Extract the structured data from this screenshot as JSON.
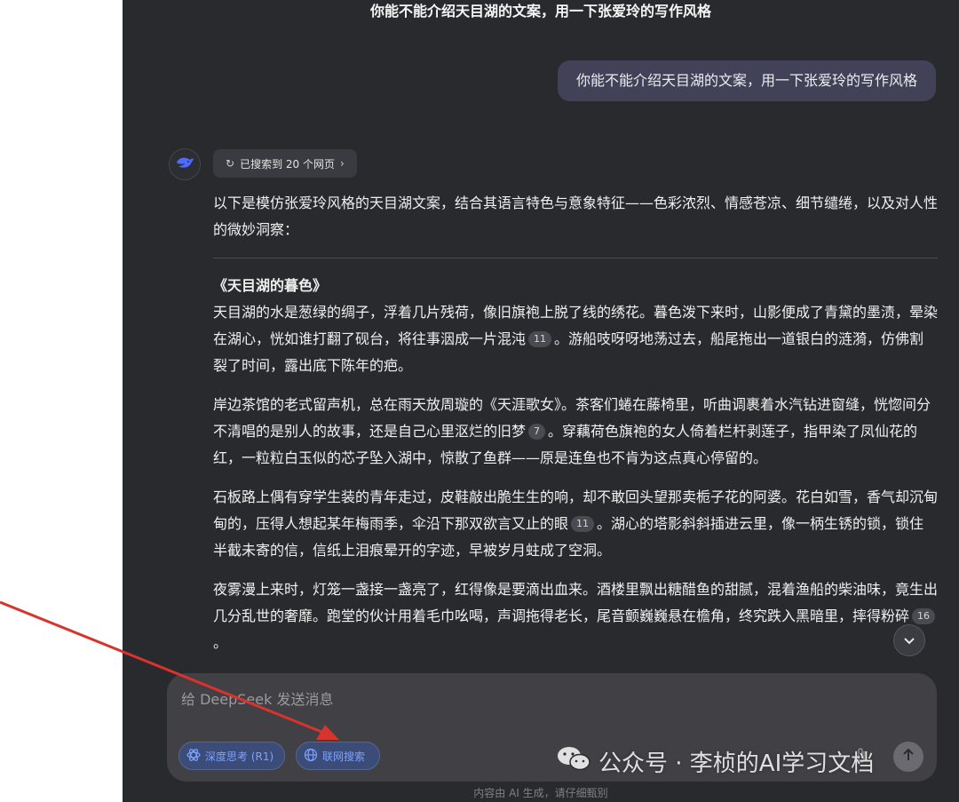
{
  "header": {
    "title": "你能不能介绍天目湖的文案，用一下张爱玲的写作风格"
  },
  "conversation": {
    "user_message": "你能不能介绍天目湖的文案，用一下张爱玲的写作风格",
    "search_status": "已搜索到 20 个网页",
    "intro": "以下是模仿张爱玲风格的天目湖文案，结合其语言特色与意象特征——色彩浓烈、情感苍凉、细节缱绻，以及对人性的微妙洞察：",
    "poem_title": "《天目湖的暮色》",
    "paragraphs": [
      {
        "a": "天目湖的水是葱绿的绸子，浮着几片残荷，像旧旗袍上脱了线的绣花。暮色泼下来时，山影便成了青黛的墨渍，晕染在湖心，恍如谁打翻了砚台，将往事洇成一片混沌",
        "cite": "11",
        "b": "。游船吱呀呀地荡过去，船尾拖出一道银白的涟漪，仿佛割裂了时间，露出底下陈年的疤。"
      },
      {
        "a": "岸边茶馆的老式留声机，总在雨天放周璇的《天涯歌女》。茶客们蜷在藤椅里，听曲调裹着水汽钻进窗缝，恍惚间分不清唱的是别人的故事，还是自己心里沤烂的旧梦",
        "cite": "7",
        "b": "。穿藕荷色旗袍的女人倚着栏杆剥莲子，指甲染了凤仙花的红，一粒粒白玉似的芯子坠入湖中，惊散了鱼群——原是连鱼也不肯为这点真心停留的。"
      },
      {
        "a": "石板路上偶有穿学生装的青年走过，皮鞋敲出脆生生的响，却不敢回头望那卖栀子花的阿婆。花白如雪，香气却沉甸甸的，压得人想起某年梅雨季，伞沿下那双欲言又止的眼",
        "cite": "11",
        "b": "。湖心的塔影斜斜插进云里，像一柄生锈的锁，锁住半截未寄的信，信纸上泪痕晕开的字迹，早被岁月蛀成了空洞。"
      },
      {
        "a": "夜雾漫上来时，灯笼一盏接一盏亮了，红得像是要滴出血来。酒楼里飘出糖醋鱼的甜腻，混着渔船的柴油味，竟生出几分乱世的奢靡。跑堂的伙计用着毛巾吆喝，声调拖得老长，尾音颤巍巍悬在檐角，终究跌入黑暗里，摔得粉碎",
        "cite": "16",
        "b": "。"
      }
    ]
  },
  "composer": {
    "placeholder": "给 DeepSeek 发送消息",
    "deep_think_label": "深度思考 (R1)",
    "web_search_label": "联网搜索"
  },
  "footer": {
    "note": "内容由 AI 生成，请仔细甄别"
  },
  "watermark": {
    "text": "公众号 · 李桢的AI学习文档"
  },
  "colors": {
    "background": "#292a2d",
    "user_bubble": "#414158",
    "accent": "#7aa2ff",
    "arrow": "#d9332b"
  },
  "icons": {
    "avatar": "deepseek-whale-icon",
    "search": "search-refresh-icon",
    "chevron": "chevron-right-icon",
    "scroll": "chevron-down-icon",
    "deep_think": "atom-icon",
    "web_search": "globe-icon",
    "attach": "paperclip-icon",
    "send": "arrow-up-icon",
    "wechat": "wechat-icon"
  }
}
